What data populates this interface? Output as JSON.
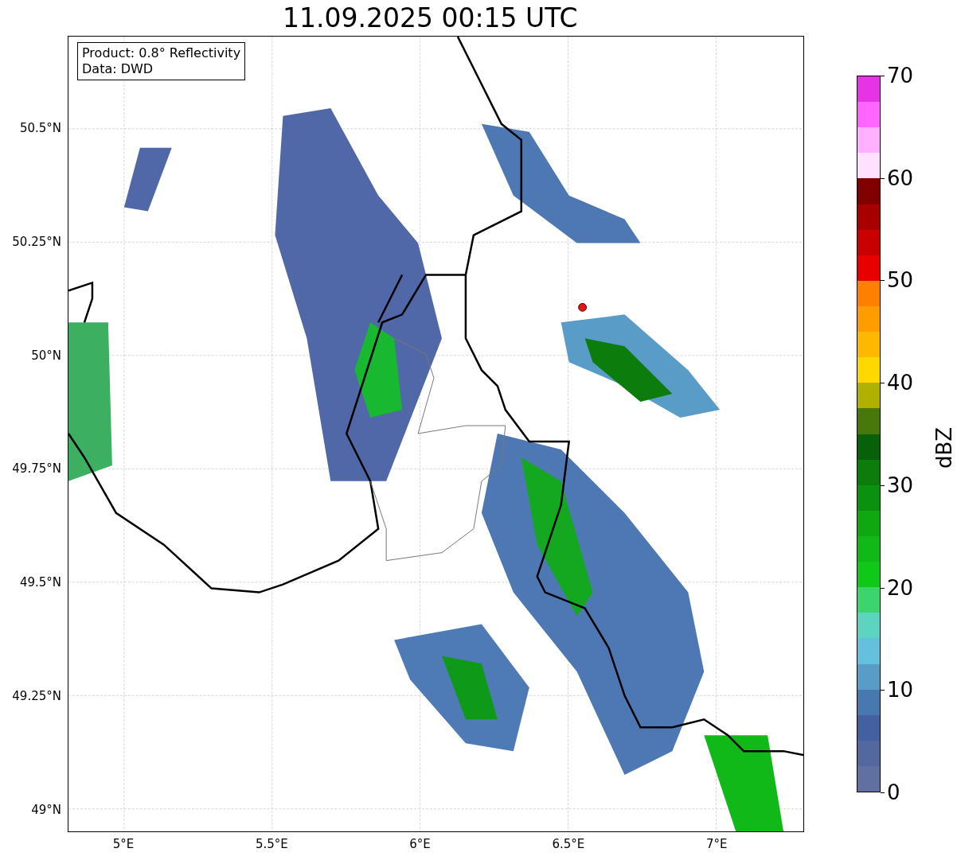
{
  "title": "11.09.2025 00:15 UTC",
  "legend": {
    "lines": [
      "Product: 0.8° Reflectivity",
      "Data: DWD"
    ]
  },
  "map": {
    "lat_ticks": [
      "50.5°N",
      "50.25°N",
      "50°N",
      "49.75°N",
      "49.5°N",
      "49.25°N",
      "49°N"
    ],
    "lon_ticks": [
      "5°E",
      "5.5°E",
      "6°E",
      "6.5°E",
      "7°E"
    ]
  },
  "colorbar": {
    "label": "dBZ",
    "ticks": [
      "70",
      "60",
      "50",
      "40",
      "30",
      "20",
      "10",
      "0"
    ],
    "bins": [
      {
        "color": "#e633e6"
      },
      {
        "color": "#ff66ff"
      },
      {
        "color": "#ffb0ff"
      },
      {
        "color": "#ffe0ff"
      },
      {
        "color": "#800000"
      },
      {
        "color": "#a80000"
      },
      {
        "color": "#c80000"
      },
      {
        "color": "#e80000"
      },
      {
        "color": "#ff8000"
      },
      {
        "color": "#ff9c00"
      },
      {
        "color": "#ffb800"
      },
      {
        "color": "#ffd800"
      },
      {
        "color": "#b0b000"
      },
      {
        "color": "#48780c"
      },
      {
        "color": "#086008"
      },
      {
        "color": "#0c7c0c"
      },
      {
        "color": "#0c9010"
      },
      {
        "color": "#10a810"
      },
      {
        "color": "#10b818"
      },
      {
        "color": "#10c818"
      },
      {
        "color": "#3cd46c"
      },
      {
        "color": "#5cd4c0"
      },
      {
        "color": "#64c0dc"
      },
      {
        "color": "#5a9cc8"
      },
      {
        "color": "#4878b0"
      },
      {
        "color": "#4460a0"
      },
      {
        "color": "#5468a0"
      },
      {
        "color": "#6070a0"
      }
    ]
  }
}
